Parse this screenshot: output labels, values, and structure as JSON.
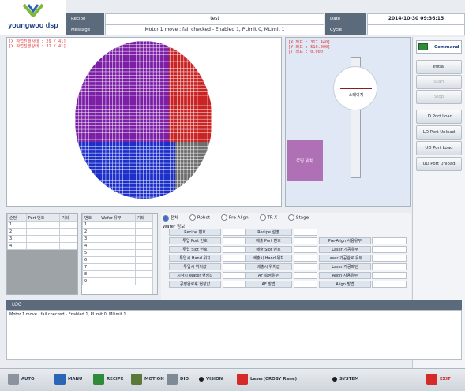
{
  "brand": {
    "logo_text": "youngwoo dsp"
  },
  "header": {
    "recipe_label": "Recipe",
    "recipe_value": "test",
    "message_label": "Message",
    "message_value": "Motor 1 move : fail checked - Enabled 1, PLimit 0, MLimit 1",
    "date_label": "Date",
    "date_value": "2014-10-30 09:36:15",
    "cycle_label": "Cycle",
    "cycle_value": ""
  },
  "wafer_map": {
    "status_line1": "[X 작업진행상태 : 29 / 41]",
    "status_line2": "[Y 작업진행상태 : 31 / 41]",
    "colors": {
      "purple": "#7c1fa6",
      "red": "#c92323",
      "blue": "#1c2fc9",
      "gray": "#6d6d6d"
    }
  },
  "stage": {
    "x_coord": "[X 좌표 : 317.440]",
    "y_coord": "[Y 좌표 : 510.000]",
    "t_coord": "[T 좌표 : 0.000]",
    "gauge_label": "스테이지",
    "load_label": "로딩 위치"
  },
  "right_menu": {
    "command_label": "Command",
    "buttons": [
      {
        "label": "Initial",
        "enabled": true
      },
      {
        "label": "Start",
        "enabled": false
      },
      {
        "label": "Stop",
        "enabled": false
      },
      {
        "label": "LD Port Load",
        "enabled": true
      },
      {
        "label": "LD Port Unload",
        "enabled": true
      },
      {
        "label": "UD Port Load",
        "enabled": true
      },
      {
        "label": "UD Port Unload",
        "enabled": true
      }
    ]
  },
  "port_table": {
    "headers": [
      "순번",
      "Port 번호",
      "기타"
    ],
    "rows": [
      "1",
      "2",
      "3",
      "4"
    ]
  },
  "wafer_table": {
    "headers": [
      "번호",
      "Wafer 유무",
      "기타"
    ],
    "rows": [
      "1",
      "2",
      "3",
      "4",
      "5",
      "6",
      "7",
      "8",
      "9"
    ]
  },
  "tabs": [
    "전체",
    "Robot",
    "Pre-Align",
    "TR-X",
    "Stage"
  ],
  "water_info": {
    "title": "Water 정보",
    "col1": [
      "Recipe 번호",
      "투입 Port 번호",
      "투입 Slot 번호",
      "투입시 Hand 위치",
      "투입시 위치값",
      "시작시 Water 현장값",
      "공정완료후 현장값"
    ],
    "col2": [
      "Recipe 설명",
      "배출 Port 번호",
      "배출 Slot 번호",
      "배출시 Hand 위치",
      "배출시 위치값",
      "AF 측정유무",
      "AF 방법"
    ],
    "col3": [
      "Pre-Align 사용유무",
      "Laser 가공유무",
      "Laser 가공완료 유무",
      "Laser 가공패턴",
      "Align 사용유무",
      "Align 방법"
    ]
  },
  "log": {
    "title": "LOG",
    "entries": [
      "Motor 1 move : fail checked - Enabled 1, PLimit 0, MLimit 1"
    ]
  },
  "bottom_menu": [
    {
      "label": "AUTO",
      "icon": "gear-icon"
    },
    {
      "label": "MANU",
      "icon": "hand-icon"
    },
    {
      "label": "RECIPE",
      "icon": "pen-icon"
    },
    {
      "label": "MOTION",
      "icon": "motion-icon"
    },
    {
      "label": "DIO",
      "icon": "dio-icon"
    },
    {
      "label": "VISION",
      "icon": "vision-icon"
    },
    {
      "label": "Laser(CROBY Rane)",
      "icon": "laser-icon"
    },
    {
      "label": "SYSTEM",
      "icon": "system-icon"
    },
    {
      "label": "EXIT",
      "icon": "power-icon"
    }
  ]
}
